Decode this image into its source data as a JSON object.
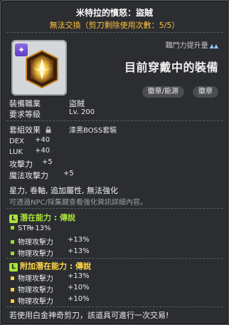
{
  "item": {
    "name": "米特拉的憤怒：盜賊",
    "trade_note": "無法交換（剪刀剩除使用次數：5/5）",
    "stat_up_label": "職鬥力提升量",
    "equipped_label": "目前穿戴中的裝備",
    "tags": [
      "徽章/能源",
      "徽章"
    ]
  },
  "requirements": [
    {
      "label": "裝備職業",
      "value": "盜賊"
    },
    {
      "label": "要求等級",
      "value": "Lv. 200"
    }
  ],
  "set_effect": {
    "label": "套組效果",
    "value": "漆黑BOSS套裝"
  },
  "stats": [
    {
      "label": "DEX",
      "value": "+40"
    },
    {
      "label": "LUK",
      "value": "+40"
    },
    {
      "label": "攻擊力",
      "value": "+5"
    },
    {
      "label": "魔法攻擊力",
      "value": "+5"
    }
  ],
  "properties": "星力, 卷軸, 追加屬性, 無法強化",
  "npc_note": "可透過NPC/採集鍵查看強化資訊詳細內容。",
  "potential": {
    "badge": "L",
    "title": "潛在能力 : 傳說",
    "lines": [
      {
        "label": "STR",
        "value": "+13%"
      },
      {
        "label": "物理攻擊力",
        "value": "+13%"
      },
      {
        "label": "物理攻擊力",
        "value": "+13%"
      }
    ]
  },
  "bonus_potential": {
    "badge": "L",
    "title": "附加潛在能力 : 傳說",
    "lines": [
      {
        "label": "物理攻擊力",
        "value": "+13%"
      },
      {
        "label": "物理攻擊力",
        "value": "+10%"
      },
      {
        "label": "物理攻擊力",
        "value": "+10%"
      }
    ]
  },
  "footer": "若使用白金神奇剪刀，該道具可進行一次交易!",
  "icons": {
    "star_badge": "star-icon",
    "item": "emblem-icon",
    "lock": "lock-icon"
  },
  "colors": {
    "title": "#ffffff",
    "trade_note": "#ffc13d",
    "potential_green": "#a8e23a",
    "bonus_potential_yellow": "#ffd84a",
    "bullet_green": "#9edc28",
    "bullet_yellow": "#ffd23a"
  }
}
